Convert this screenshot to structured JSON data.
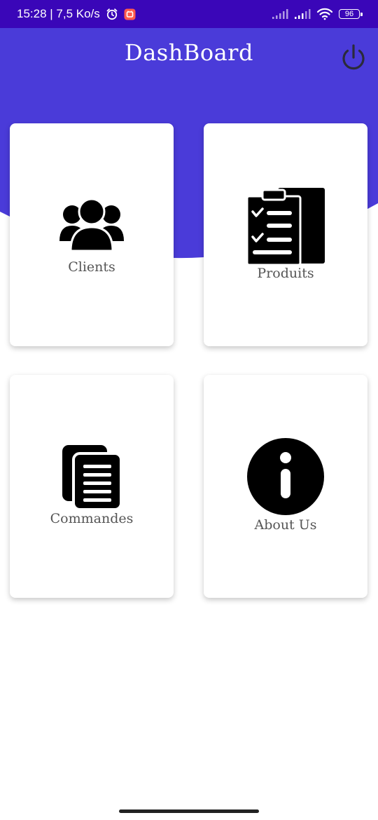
{
  "status_bar": {
    "time_speed": "15:28 | 7,5 Ko/s",
    "battery": "96",
    "icons": [
      "alarm-icon",
      "notification-app-icon",
      "signal-icon",
      "signal-icon",
      "wifi-icon",
      "battery-icon"
    ]
  },
  "header": {
    "title": "DashBoard",
    "background_color": "#4a3bd9",
    "power_icon": "power-icon"
  },
  "cards": [
    {
      "label": "Clients",
      "icon": "users-icon"
    },
    {
      "label": "Produits",
      "icon": "clipboard-checklist-icon"
    },
    {
      "label": "Commandes",
      "icon": "documents-icon"
    },
    {
      "label": "About Us",
      "icon": "info-icon"
    }
  ]
}
